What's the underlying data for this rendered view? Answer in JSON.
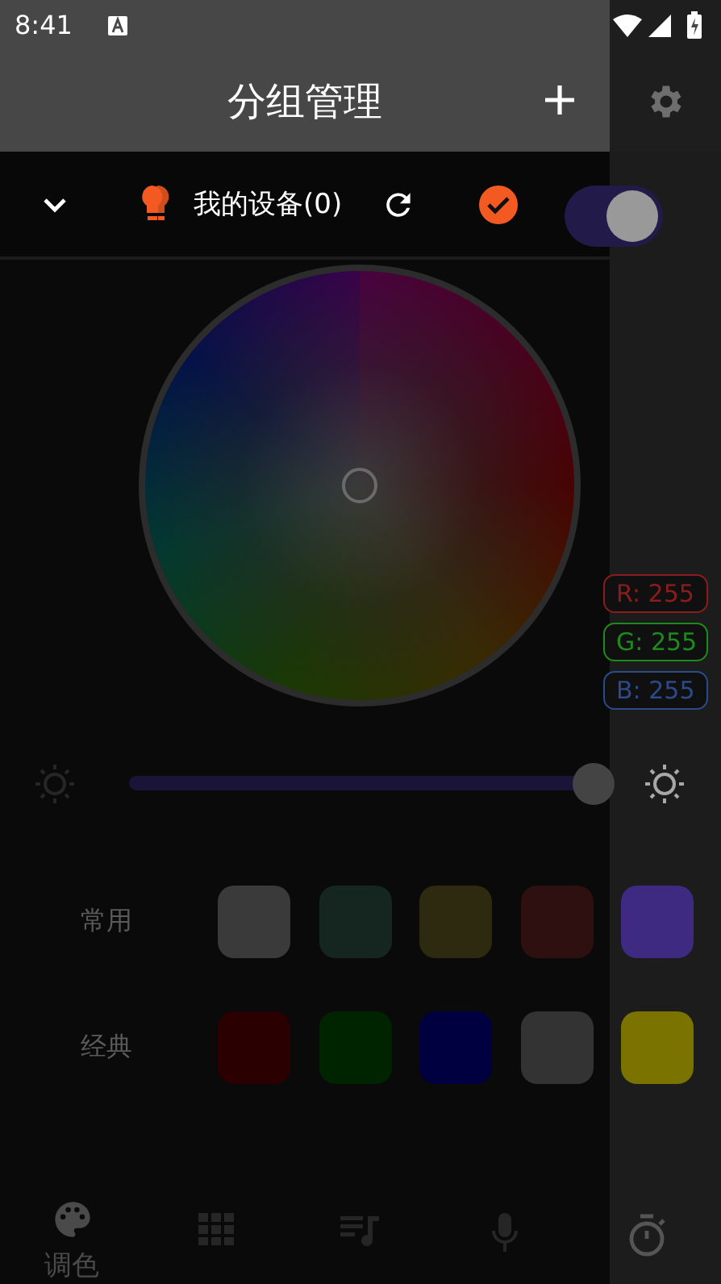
{
  "status_bar": {
    "time": "8:41"
  },
  "header": {
    "title": "分组管理"
  },
  "device_bar": {
    "name": "我的设备(0)",
    "selected": true,
    "on": true
  },
  "rgb_readouts": [
    {
      "label": "R: 255",
      "color": "#8a1c1c"
    },
    {
      "label": "G: 255",
      "color": "#1c8a1c"
    },
    {
      "label": "B: 255",
      "color": "#2a4a8a"
    }
  ],
  "brightness": {
    "level": 1
  },
  "swatch_rows": [
    {
      "label": "常用",
      "swatches": [
        {
          "color": "#3a3a3a"
        },
        {
          "color": "#14261f"
        },
        {
          "color": "#2e2a10"
        },
        {
          "color": "#2e1010"
        },
        {
          "color": "#3e2a80"
        }
      ]
    },
    {
      "label": "经典",
      "swatches": [
        {
          "color": "#2a0000"
        },
        {
          "color": "#002400"
        },
        {
          "color": "#000040"
        },
        {
          "color": "#333333"
        },
        {
          "color": "#7a7300"
        }
      ]
    }
  ],
  "tabs": [
    {
      "kind": "palette",
      "label": "调色",
      "selected": true
    },
    {
      "kind": "grid",
      "selected": false
    },
    {
      "kind": "playlist",
      "selected": false
    },
    {
      "kind": "mic",
      "selected": false
    },
    {
      "kind": "timer",
      "selected": false
    }
  ]
}
